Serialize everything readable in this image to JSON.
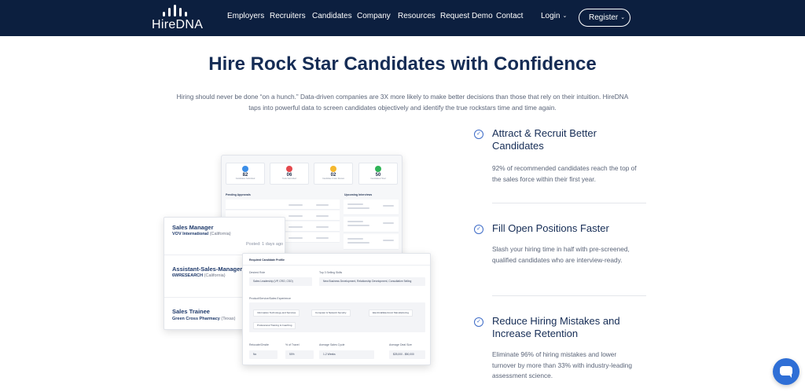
{
  "brand": {
    "logo_text": "HireDNA"
  },
  "nav": {
    "links": [
      "Employers",
      "Recruiters",
      "Candidates",
      "Company",
      "Resources",
      "Request Demo",
      "Contact"
    ],
    "login": "Login",
    "register": "Register"
  },
  "hero": {
    "title": "Hire Rock Star Candidates with Confidence",
    "subtitle": "Hiring should never be done “on a hunch.” Data-driven companies are 3X more likely to make better decisions than those that rely on their intuition. HireDNA taps into powerful data to screen candidates objectively and identify the true rockstars time and time again."
  },
  "dashboard": {
    "stats": [
      {
        "value": "82",
        "label": "Candidates Submitted",
        "color": "#3b8ee8"
      },
      {
        "value": "06",
        "label": "Tests Submitted",
        "color": "#e5484d"
      },
      {
        "value": "02",
        "label": "Candidate Under Review",
        "color": "#f5b82e"
      },
      {
        "value": "50",
        "label": "Candidates Hired",
        "color": "#2fb457"
      }
    ],
    "pending_heading": "Pending Approvals",
    "upcoming_heading": "Upcoming Interviews"
  },
  "jobs": [
    {
      "title": "Sales Manager",
      "company": "VOV International",
      "location": "(California)",
      "posted": "Posted: 1 days ago"
    },
    {
      "title": "Assistant-Sales-Manager",
      "company": "6WRESEARCH",
      "location": "(California)"
    },
    {
      "title": "Sales Trainee",
      "company": "Green Cross Pharmacy",
      "location": "(Texas)"
    }
  ],
  "profile": {
    "heading": "Required Candidate Profile",
    "desired_role_label": "Desired Role",
    "desired_role": "Sales Leadership (VP, CRO, CSO)",
    "skills_label": "Top 3 Selling Skills",
    "skills": "New Business Development, Relationship Development, Consultative Selling",
    "experience_label": "Product/Service/Sales Experience",
    "chips": [
      "Information Technology and Services",
      "Computer & Network Security",
      "Electrical/Electronic Manufacturing",
      "Professional Training & Coaching"
    ],
    "fields": [
      {
        "label": "Relocate/Onsite",
        "value": "No"
      },
      {
        "label": "% of Travel",
        "value": "50%"
      },
      {
        "label": "Average Sales Cycle",
        "value": "1-2 Weeks"
      },
      {
        "label": "Average Deal Size",
        "value": "$25,000 - $50,000"
      }
    ]
  },
  "features": [
    {
      "title": "Attract & Recruit Better Candidates",
      "body": "92% of recommended candidates reach the top of the sales force within their first year."
    },
    {
      "title": "Fill Open Positions Faster",
      "body": "Slash your hiring time in half with pre-screened, qualified candidates who are interview-ready."
    },
    {
      "title": "Reduce Hiring Mistakes and Increase Retention",
      "body": "Eliminate 96% of hiring mistakes and lower turnover by more than 33% with industry-leading assessment science."
    }
  ]
}
